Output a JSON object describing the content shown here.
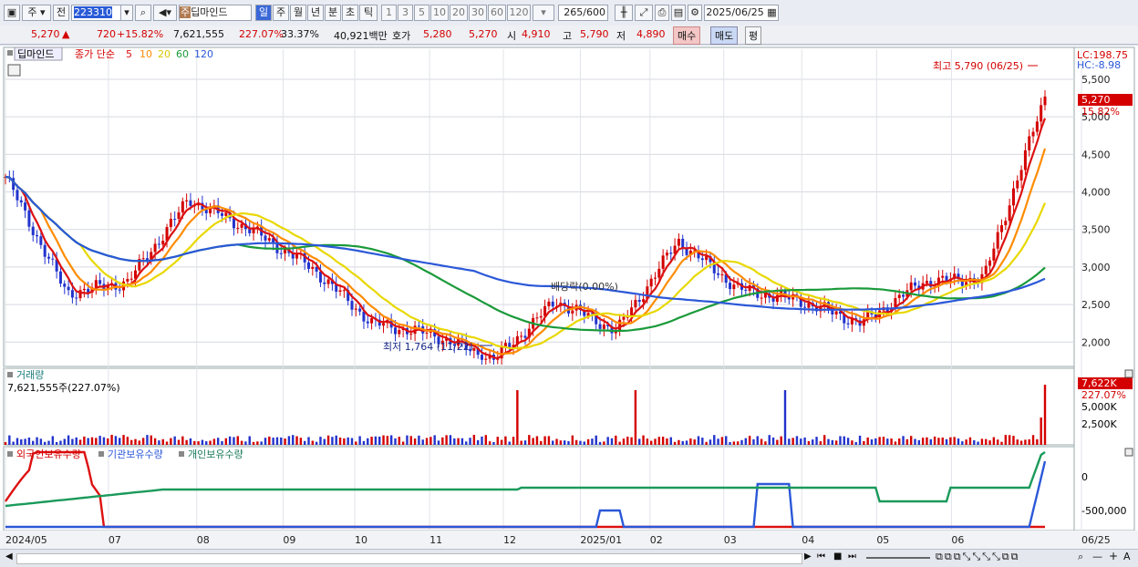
{
  "toolbar": {
    "market_type": "주",
    "prev_label": "전",
    "code": "223310",
    "stock_tag": "주",
    "stock_name": "딥마인드",
    "periods": [
      "일",
      "주",
      "월",
      "년",
      "분",
      "초",
      "틱"
    ],
    "active_period": "일",
    "intervals": [
      "1",
      "3",
      "5",
      "10",
      "20",
      "30",
      "60",
      "120"
    ],
    "count": "265",
    "count_total": "/600",
    "date": "2025/06/25"
  },
  "quote": {
    "price": "5,270",
    "arrow": "▲",
    "change": "720",
    "change_pct": "+15.82%",
    "volume": "7,621,555",
    "volume_ratio": "227.07%",
    "turnover_pct": "33.37%",
    "amount": "40,921백만",
    "bid_label": "호가",
    "bid": "5,280",
    "ask": "5,270",
    "open_label": "시",
    "open": "4,910",
    "high_label": "고",
    "high": "5,790",
    "low_label": "저",
    "low": "4,890",
    "buy_label": "매수",
    "sell_label": "매도",
    "avg_label": "평"
  },
  "price_panel": {
    "name_tag": "딥마인드",
    "indicator_label": "종가 단순",
    "ma_periods": [
      "5",
      "10",
      "20",
      "60",
      "120"
    ],
    "ma_colors": [
      "#dd1111",
      "#ff8c00",
      "#e8d800",
      "#1a9a3a",
      "#2b58d8"
    ],
    "lc_label": "LC:198.75",
    "hc_label": "HC:-8.98",
    "price_ticks": [
      "5,500",
      "5,000",
      "4,500",
      "4,000",
      "3,500",
      "3,000",
      "2,500",
      "2,000"
    ],
    "current_price": "5,270",
    "current_pct": "15.82%",
    "high_annotation": "최고 5,790 (06/25)",
    "low_annotation": "최저 1,764 (11/22)",
    "dividend_annotation": "배당락(0.00%)"
  },
  "volume_panel": {
    "title": "거래량",
    "value_text": "7,621,555주(227.07%)",
    "current": "7,622K",
    "current_pct": "227.07%",
    "ticks": [
      "5,000K",
      "2,500K"
    ]
  },
  "holding_panel": {
    "legend": [
      "외국인보유수량",
      "기관보유수량",
      "개인보유수량"
    ],
    "colors": [
      "#dd1111",
      "#2b58d8",
      "#1a9a5a"
    ],
    "ticks": [
      "0",
      "-500,000"
    ]
  },
  "x_axis": [
    "2024/05",
    "07",
    "08",
    "09",
    "10",
    "11",
    "12",
    "2025/01",
    "02",
    "03",
    "04",
    "05",
    "06",
    "06/25"
  ],
  "chart_data": {
    "type": "candlestick",
    "title": "딥마인드",
    "ylim": [
      1700,
      5900
    ],
    "close_series": [
      {
        "date": "2024/05",
        "close": 4200
      },
      {
        "date": "2024/06",
        "close": 2650
      },
      {
        "date": "2024/07",
        "close": 2800
      },
      {
        "date": "2024/07 mid",
        "close": 3900
      },
      {
        "date": "2024/08",
        "close": 3500
      },
      {
        "date": "2024/09",
        "close": 3000
      },
      {
        "date": "2024/10",
        "close": 2250
      },
      {
        "date": "2024/11",
        "close": 2100
      },
      {
        "date": "2024/11/22",
        "close": 1764
      },
      {
        "date": "2024/12",
        "close": 2550
      },
      {
        "date": "2024/12 late",
        "close": 2150
      },
      {
        "date": "2025/01",
        "close": 3350
      },
      {
        "date": "2025/02",
        "close": 2700
      },
      {
        "date": "2025/03",
        "close": 2550
      },
      {
        "date": "2025/04",
        "close": 2250
      },
      {
        "date": "2025/05",
        "close": 2800
      },
      {
        "date": "2025/06",
        "close": 2850
      },
      {
        "date": "2025/06/25",
        "close": 5270
      }
    ],
    "annotations": {
      "high": 5790,
      "high_date": "06/25",
      "low": 1764,
      "low_date": "11/22"
    }
  }
}
